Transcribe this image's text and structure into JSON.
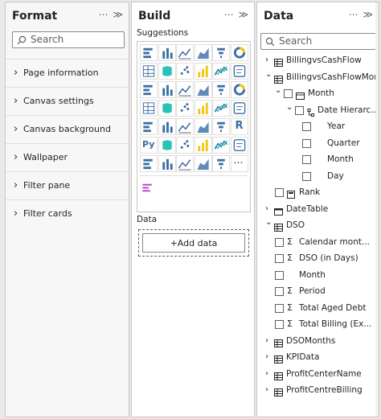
{
  "format": {
    "title": "Format",
    "search_placeholder": "Search",
    "sections": [
      "Page information",
      "Canvas settings",
      "Canvas background",
      "Wallpaper",
      "Filter pane",
      "Filter cards"
    ]
  },
  "build": {
    "title": "Build",
    "suggestions_label": "Suggestions",
    "data_label": "Data",
    "add_data_label": "+Add data",
    "visuals": [
      "stacked-bar-chart",
      "stacked-column-chart",
      "clustered-bar-chart",
      "clustered-column-chart",
      "100-stacked-bar-chart",
      "100-stacked-column-chart",
      "line-chart",
      "area-chart",
      "stacked-area-chart",
      "line-and-column-chart",
      "line-and-clustered-column-chart",
      "ribbon-chart",
      "waterfall-chart",
      "funnel-chart",
      "scatter-chart",
      "pie-chart",
      "donut-chart",
      "treemap",
      "map",
      "filled-map",
      "shape-map",
      "azure-map",
      "gauge",
      "card",
      "multi-row-card",
      "kpi",
      "slicer",
      "table",
      "matrix",
      "r-visual",
      "python-visual",
      "key-influencers",
      "decomposition-tree",
      "qa",
      "smart-narrative",
      "paginated-report",
      "power-apps",
      "power-automate",
      "arcgis-map",
      "narrative",
      "funnel-visual",
      "more-visuals"
    ],
    "extra_visual": "bar-chart-custom"
  },
  "data": {
    "title": "Data",
    "search_placeholder": "Search",
    "tree": [
      {
        "label": "BillingvsCashFlow",
        "level": 0,
        "type": "table",
        "expanded": false
      },
      {
        "label": "BillingvsCashFlowMon...",
        "level": 0,
        "type": "table",
        "expanded": true
      },
      {
        "label": "Month",
        "level": 1,
        "type": "date-field",
        "expanded": true,
        "checkbox": true
      },
      {
        "label": "Date Hierarc...",
        "level": 2,
        "type": "hierarchy",
        "expanded": true,
        "checkbox": true
      },
      {
        "label": "Year",
        "level": 3,
        "type": "field",
        "checkbox": true
      },
      {
        "label": "Quarter",
        "level": 3,
        "type": "field",
        "checkbox": true
      },
      {
        "label": "Month",
        "level": 3,
        "type": "field",
        "checkbox": true
      },
      {
        "label": "Day",
        "level": 3,
        "type": "field",
        "checkbox": true
      },
      {
        "label": "Rank",
        "level": 1,
        "type": "calc-field",
        "checkbox": true
      },
      {
        "label": "DateTable",
        "level": 0,
        "type": "calendar-table",
        "expanded": false
      },
      {
        "label": "DSO",
        "level": 0,
        "type": "table",
        "expanded": true
      },
      {
        "label": "Calendar mont...",
        "level": 1,
        "type": "sigma",
        "checkbox": true
      },
      {
        "label": "DSO (in Days)",
        "level": 1,
        "type": "sigma",
        "checkbox": true
      },
      {
        "label": "Month",
        "level": 1,
        "type": "field",
        "checkbox": true
      },
      {
        "label": "Period",
        "level": 1,
        "type": "sigma",
        "checkbox": true
      },
      {
        "label": "Total Aged Debt",
        "level": 1,
        "type": "sigma",
        "checkbox": true
      },
      {
        "label": "Total Billing (Ex...",
        "level": 1,
        "type": "sigma",
        "checkbox": true
      },
      {
        "label": "DSOMonths",
        "level": 0,
        "type": "table",
        "expanded": false
      },
      {
        "label": "KPIData",
        "level": 0,
        "type": "table",
        "expanded": false
      },
      {
        "label": "ProfitCenterName",
        "level": 0,
        "type": "table",
        "expanded": false
      },
      {
        "label": "ProfitCentreBilling",
        "level": 0,
        "type": "table",
        "expanded": false
      }
    ]
  },
  "icons": {
    "more": "⋯",
    "collapse": "≫",
    "chevron_right": "›",
    "chevron_down": "⌄",
    "sigma": "Σ"
  }
}
